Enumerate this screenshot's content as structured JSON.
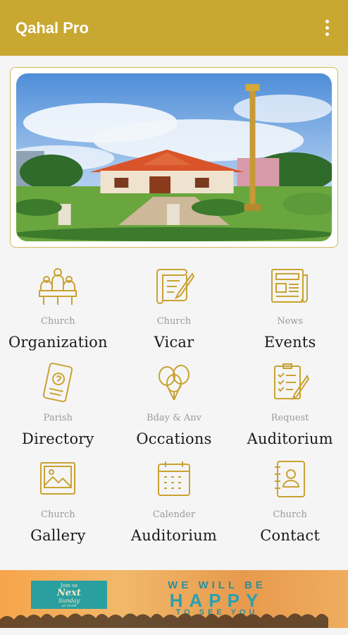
{
  "appbar": {
    "title": "Qahal Pro",
    "menu_icon": "more-vert-icon"
  },
  "hero": {
    "image": "church-building-photo"
  },
  "menu": [
    {
      "sub": "Church",
      "main": "Organization",
      "icon": "organization-icon"
    },
    {
      "sub": "Church",
      "main": "Vicar",
      "icon": "scroll-quill-icon"
    },
    {
      "sub": "News",
      "main": "Events",
      "icon": "newspaper-icon"
    },
    {
      "sub": "Parish",
      "main": "Directory",
      "icon": "phone-icon"
    },
    {
      "sub": "Bday & Anv",
      "main": "Occations",
      "icon": "balloons-icon"
    },
    {
      "sub": "Request",
      "main": "Auditorium",
      "icon": "checklist-icon"
    },
    {
      "sub": "Church",
      "main": "Gallery",
      "icon": "gallery-icon"
    },
    {
      "sub": "Calender",
      "main": "Auditorium",
      "icon": "calendar-icon"
    },
    {
      "sub": "Church",
      "main": "Contact",
      "icon": "contacts-book-icon"
    }
  ],
  "banner": {
    "box_line1": "Join us",
    "box_line2": "Next",
    "box_line3": "Sunday",
    "box_line4": "at 10:00",
    "line1": "WE WILL BE",
    "line2": "HAPPY",
    "line3": "TO SEE YOU"
  },
  "colors": {
    "accent": "#c9a832",
    "icon_gold": "#c9a232",
    "banner_teal": "#2a9fa0"
  }
}
